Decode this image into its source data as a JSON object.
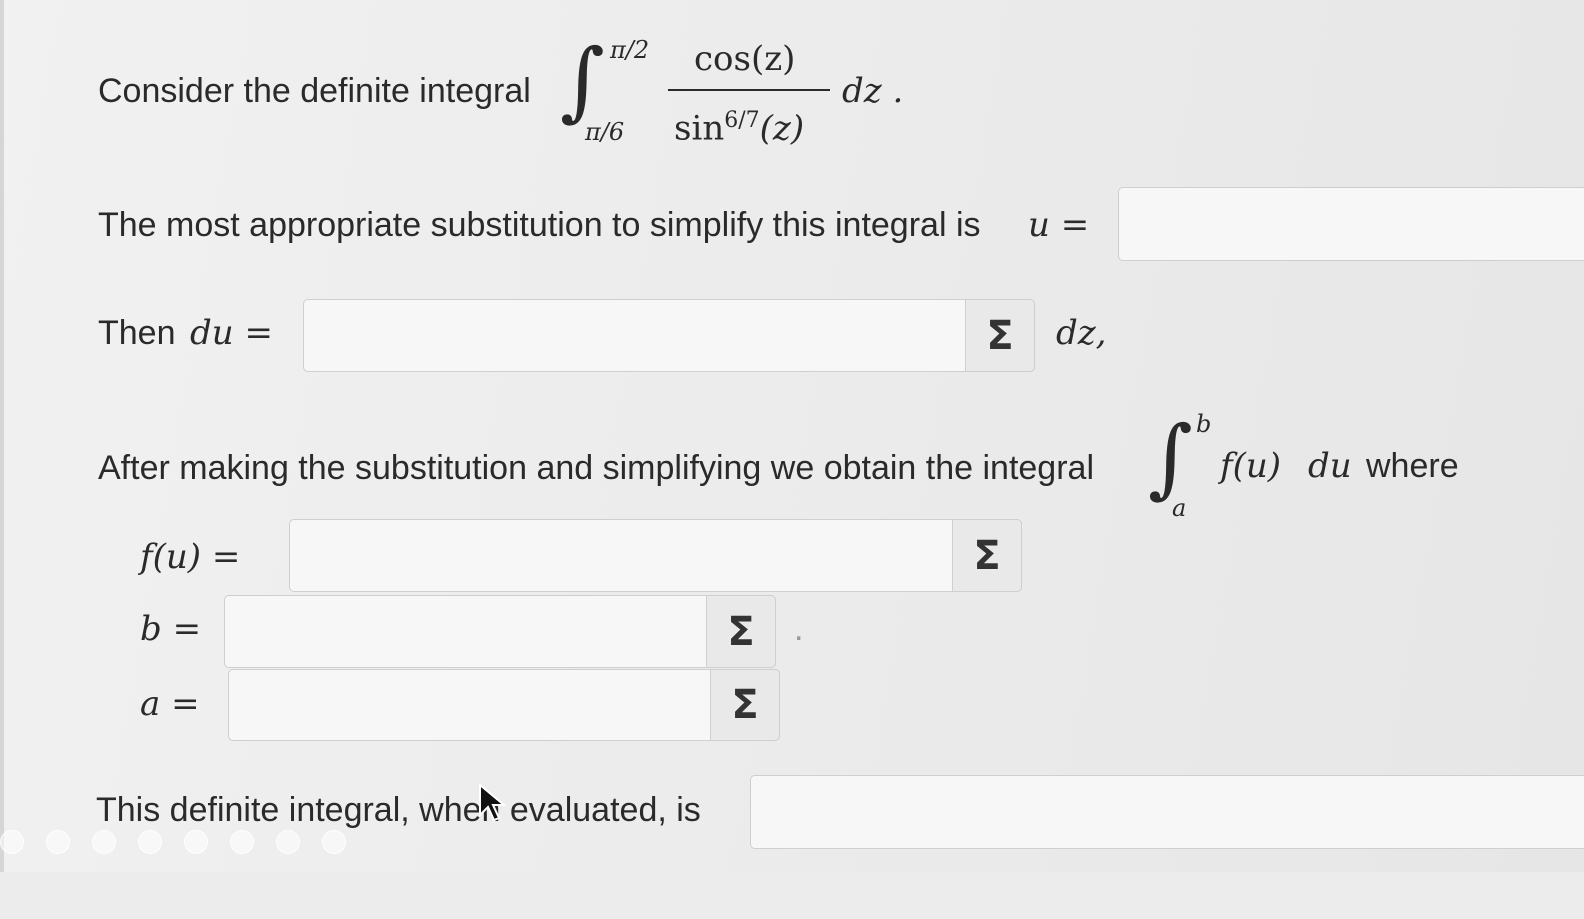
{
  "q1": {
    "prefix": "Consider the definite integral",
    "upper": "π/2",
    "lower": "π/6",
    "numerator": "cos(z)",
    "den_sin": "sin",
    "den_exp": "6/7",
    "den_arg": "(z)",
    "dz": "dz ."
  },
  "q2": {
    "prefix": "The most appropriate substitution to simplify this integral is",
    "var": "u =",
    "value": ""
  },
  "q3": {
    "prefix": "Then",
    "var": "du =",
    "value": "",
    "suffix": "dz,"
  },
  "q4": {
    "prefix": "After making the substitution and simplifying we obtain the integral",
    "upper": "b",
    "lower": "a",
    "body_f": "f(u)",
    "body_du": "du",
    "suffix": "where"
  },
  "fu": {
    "label": "f(u) =",
    "value": ""
  },
  "b": {
    "label": "b =",
    "value": "",
    "trail": "."
  },
  "a": {
    "label": "a =",
    "value": ""
  },
  "final": {
    "text": "This definite integral, when evaluated, is",
    "value": ""
  },
  "sigma_symbol": "Σ"
}
